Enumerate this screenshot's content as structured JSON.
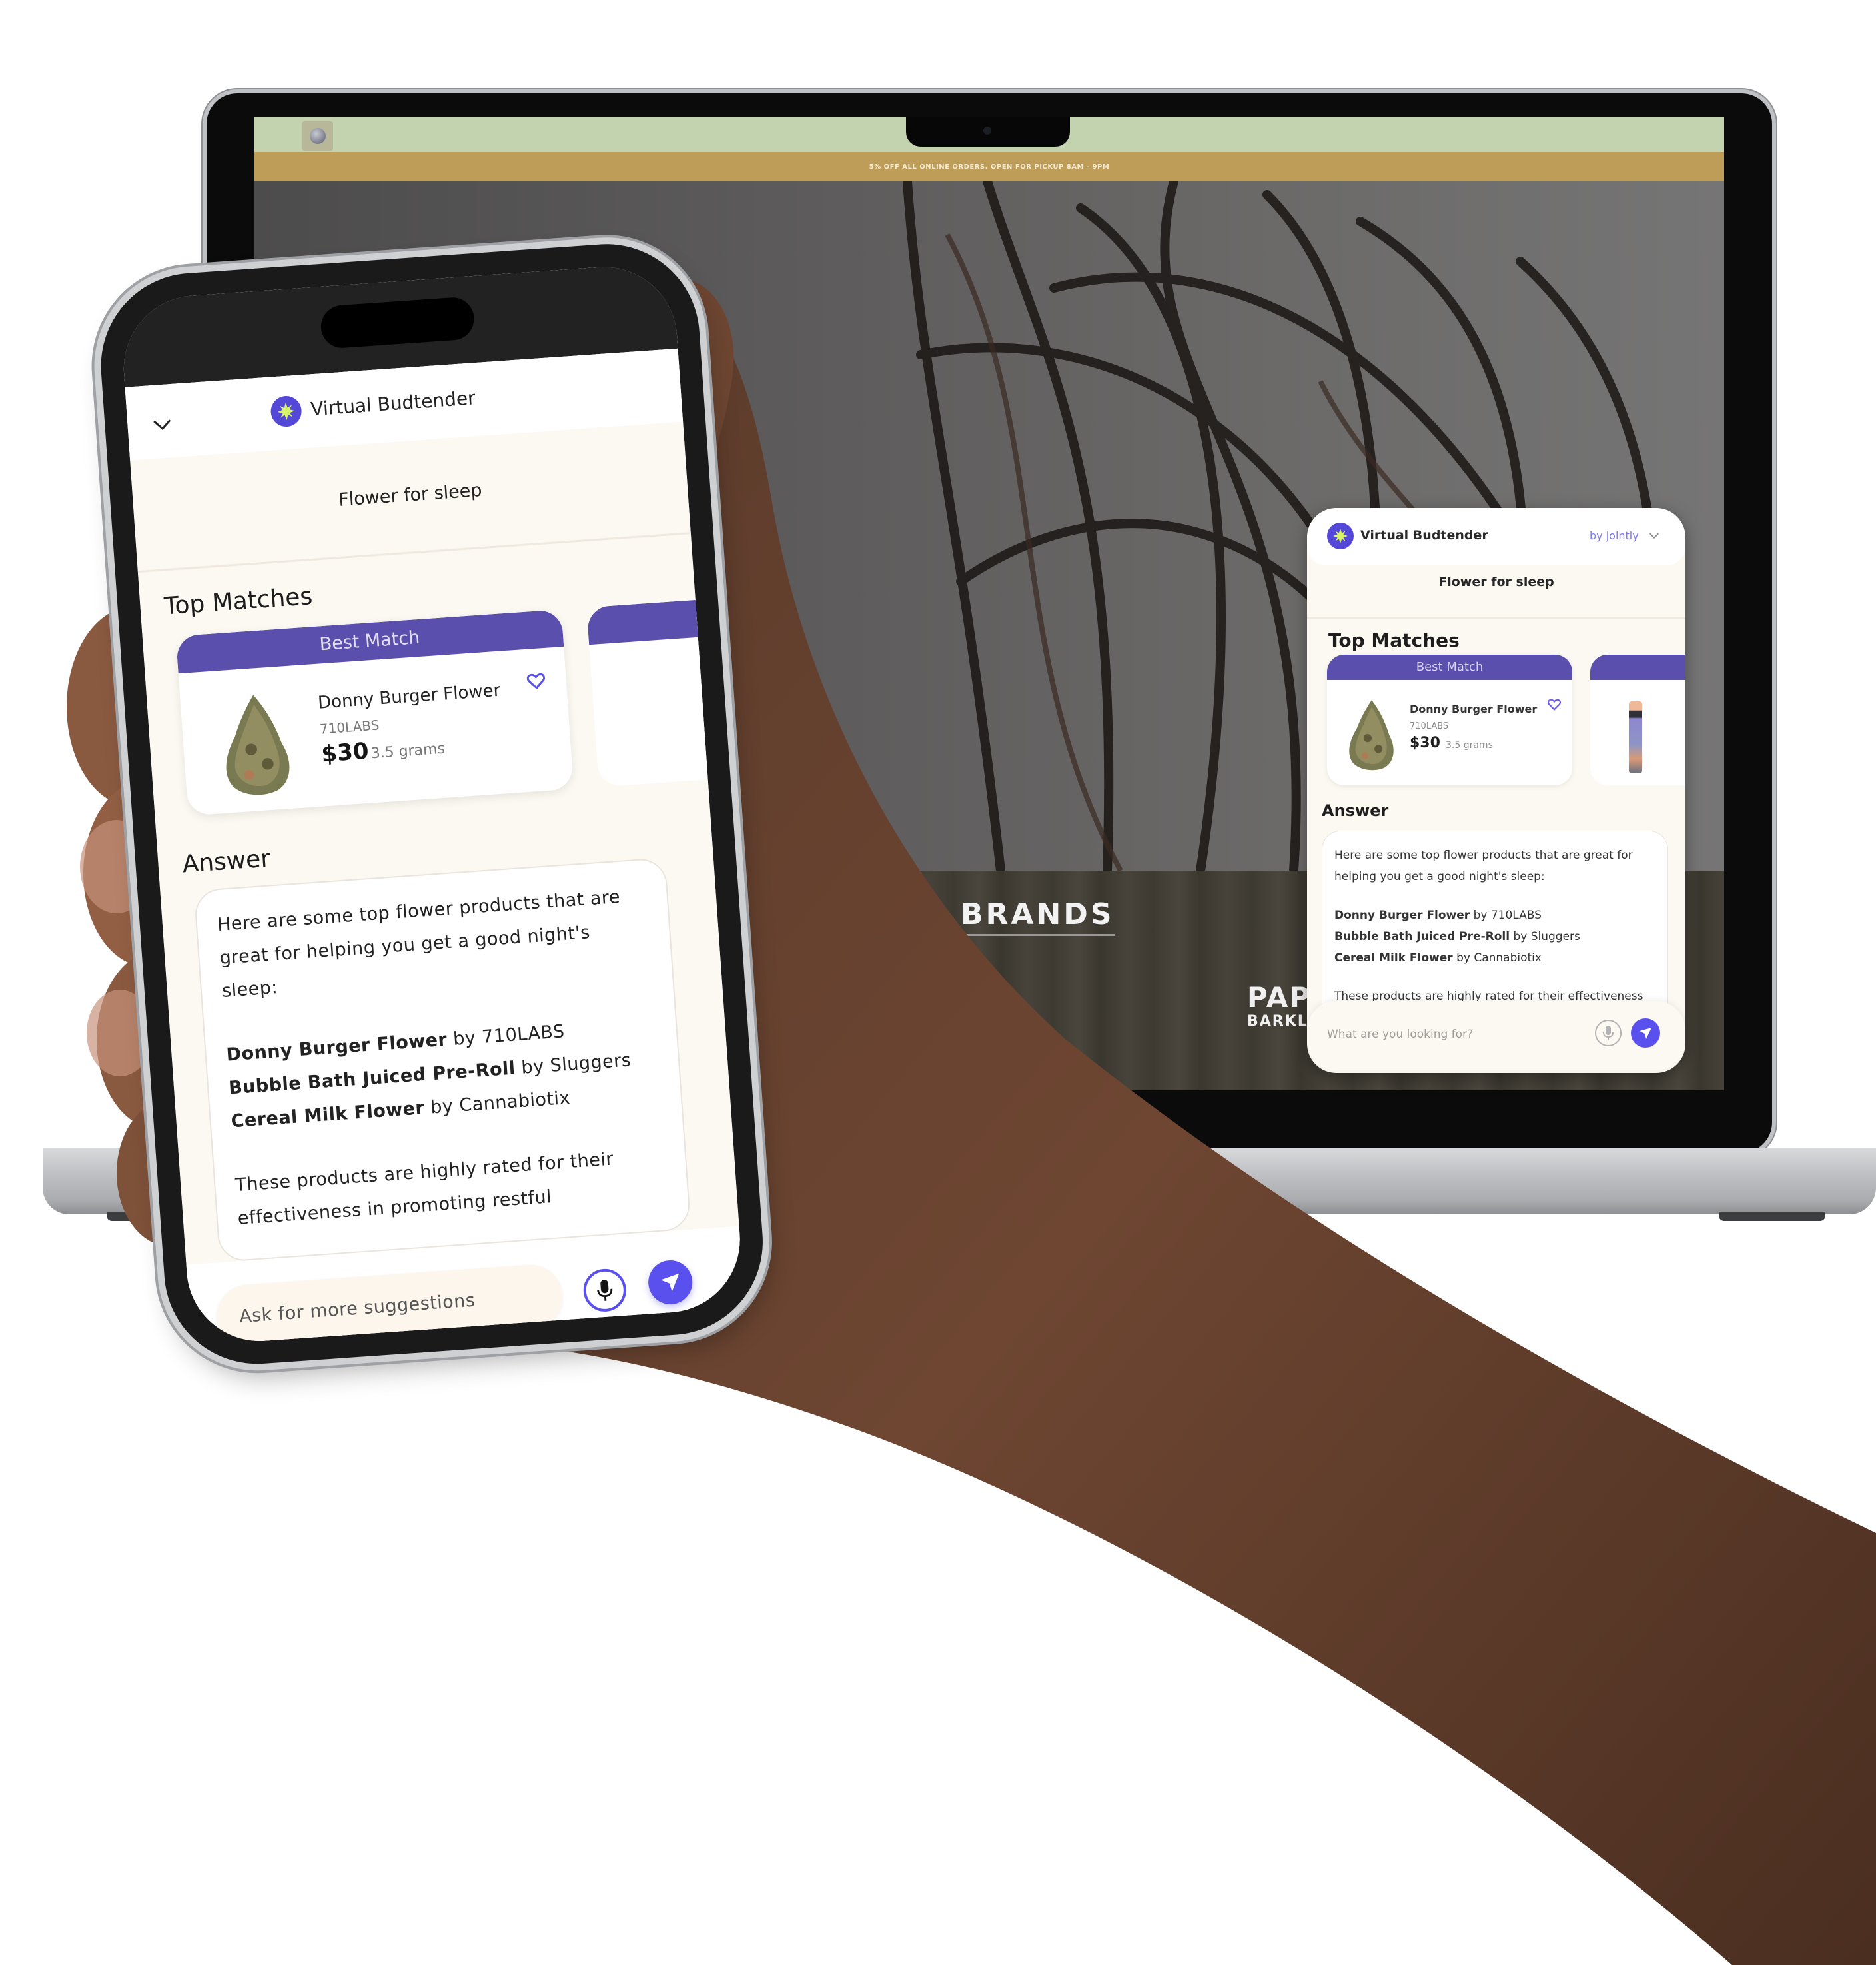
{
  "laptop": {
    "site": {
      "logo_icon": "store-logo-icon",
      "promo_banner": "5% OFF ALL ONLINE ORDERS. OPEN FOR PICKUP 8AM - 9PM",
      "section_heading": "BRANDS",
      "brand_logo_line1": "PAPA",
      "brand_logo_amp": "&",
      "brand_logo_line2": "BARKLEY"
    },
    "widget": {
      "title": "Virtual Budtender",
      "byline": "by jointly",
      "query": "Flower for sleep",
      "top_matches_heading": "Top Matches",
      "best_match_label": "Best Match",
      "product": {
        "name": "Donny Burger Flower",
        "brand": "710LABS",
        "price": "$30",
        "size": "3.5 grams"
      },
      "answer_heading": "Answer",
      "answer": {
        "intro": "Here are some top flower products that are great for helping you get a good night's sleep:",
        "items": [
          {
            "product": "Donny Burger Flower",
            "by": " by 710LABS"
          },
          {
            "product": "Bubble Bath Juiced Pre-Roll",
            "by": " by Sluggers"
          },
          {
            "product": "Cereal Milk Flower",
            "by": " by Cannabiotix"
          }
        ],
        "outro": "These products are highly rated for their effectiveness in promoting restful sleep. Enjoy!"
      },
      "input_placeholder": "What are you looking for?"
    }
  },
  "phone": {
    "widget": {
      "title": "Virtual Budtender",
      "query": "Flower for sleep",
      "top_matches_heading": "Top Matches",
      "best_match_label": "Best Match",
      "product": {
        "name": "Donny Burger Flower",
        "brand": "710LABS",
        "price": "$30",
        "size": "3.5 grams"
      },
      "answer_heading": "Answer",
      "answer": {
        "intro": "Here are some top flower products that are great for helping you get a good night's sleep:",
        "items": [
          {
            "product": "Donny Burger Flower",
            "by": " by 710LABS"
          },
          {
            "product": "Bubble Bath Juiced Pre-Roll",
            "by": " by Sluggers"
          },
          {
            "product": "Cereal Milk Flower",
            "by": " by Cannabiotix"
          }
        ],
        "outro": "These products are highly rated for their effectiveness in promoting restful"
      },
      "input_placeholder": "Ask for more suggestions"
    }
  },
  "colors": {
    "accent": "#5a50ee",
    "band": "#5a4fad",
    "logo_sun": "#d8f36a",
    "widget_bg": "#fcf8f2",
    "site_header": "#c4d3af",
    "promo_bar": "#bd9d58"
  },
  "icons": {
    "collapse": "chevron-down-icon",
    "favorite": "heart-icon",
    "microphone": "microphone-icon",
    "send": "send-icon",
    "logo": "sun-logo-icon"
  }
}
